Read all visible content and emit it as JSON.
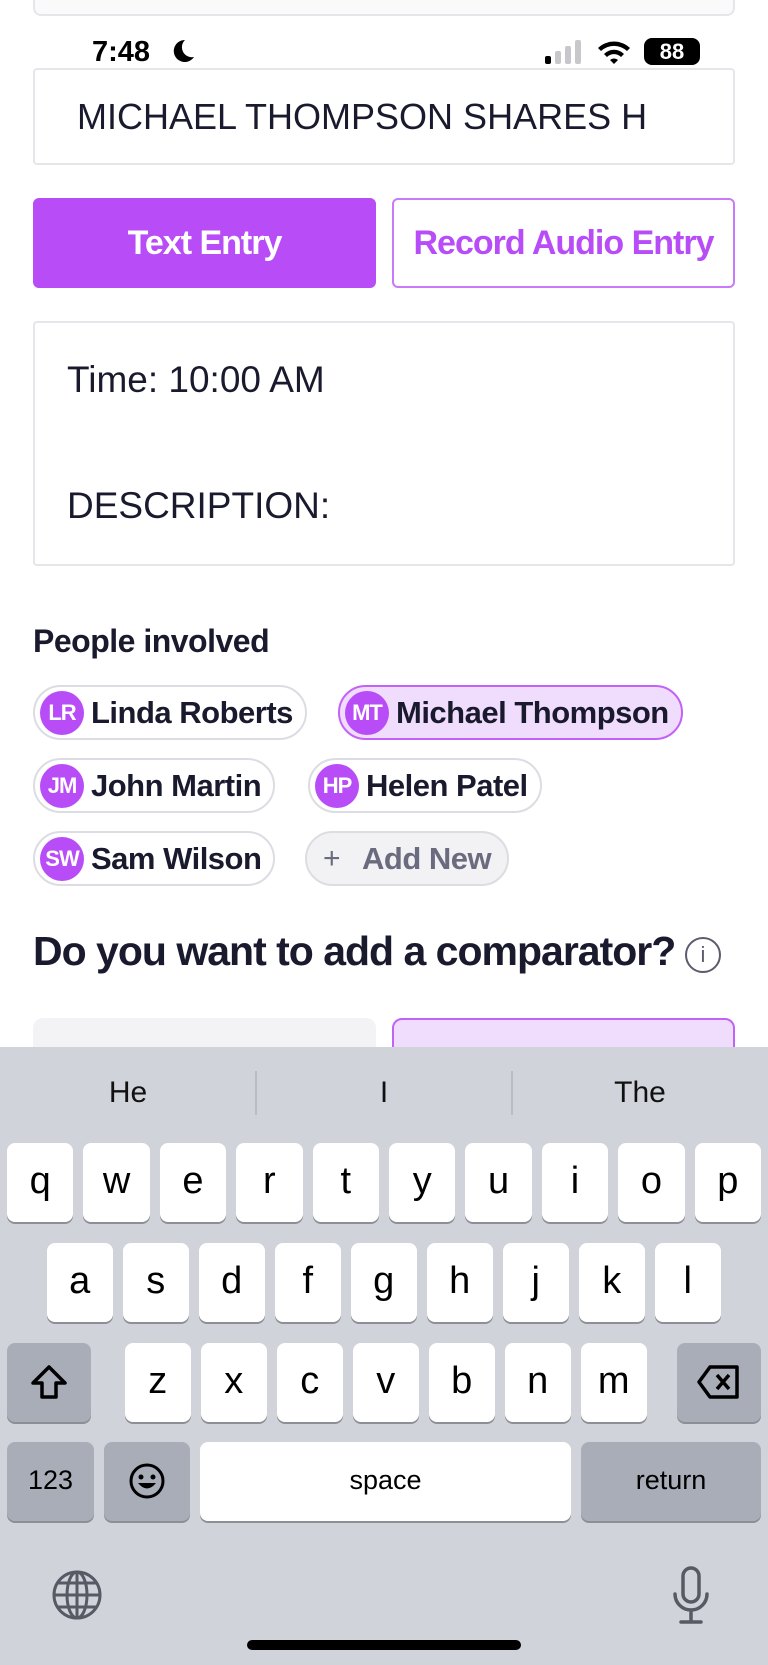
{
  "status_bar": {
    "time": "7:48",
    "battery": "88",
    "icons": [
      "moon-icon",
      "signal-icon",
      "wifi-icon",
      "battery-icon"
    ]
  },
  "title_input": {
    "value": "MICHAEL THOMPSON SHARES H"
  },
  "entry_modes": {
    "text_entry": "Text Entry",
    "audio_entry": "Record Audio Entry"
  },
  "description": {
    "line1": "Time: 10:00 AM",
    "line2": "DESCRIPTION:"
  },
  "people": {
    "heading": "People involved",
    "chips": [
      {
        "initials": "LR",
        "name": "Linda Roberts",
        "selected": false
      },
      {
        "initials": "MT",
        "name": "Michael Thompson",
        "selected": true
      },
      {
        "initials": "JM",
        "name": "John Martin",
        "selected": false
      },
      {
        "initials": "HP",
        "name": "Helen Patel",
        "selected": false
      },
      {
        "initials": "SW",
        "name": "Sam Wilson",
        "selected": false
      }
    ],
    "add_new": "Add New"
  },
  "comparator": {
    "heading": "Do you want to add a comparator?"
  },
  "colors": {
    "accent": "#b84cf7",
    "accent_light": "#f0dcfc",
    "keyboard_bg": "#d1d3da"
  },
  "keyboard": {
    "suggestions": [
      "He",
      "I",
      "The"
    ],
    "row1": [
      "q",
      "w",
      "e",
      "r",
      "t",
      "y",
      "u",
      "i",
      "o",
      "p"
    ],
    "row2": [
      "a",
      "s",
      "d",
      "f",
      "g",
      "h",
      "j",
      "k",
      "l"
    ],
    "row3": [
      "z",
      "x",
      "c",
      "v",
      "b",
      "n",
      "m"
    ],
    "numbers": "123",
    "space": "space",
    "return": "return"
  }
}
